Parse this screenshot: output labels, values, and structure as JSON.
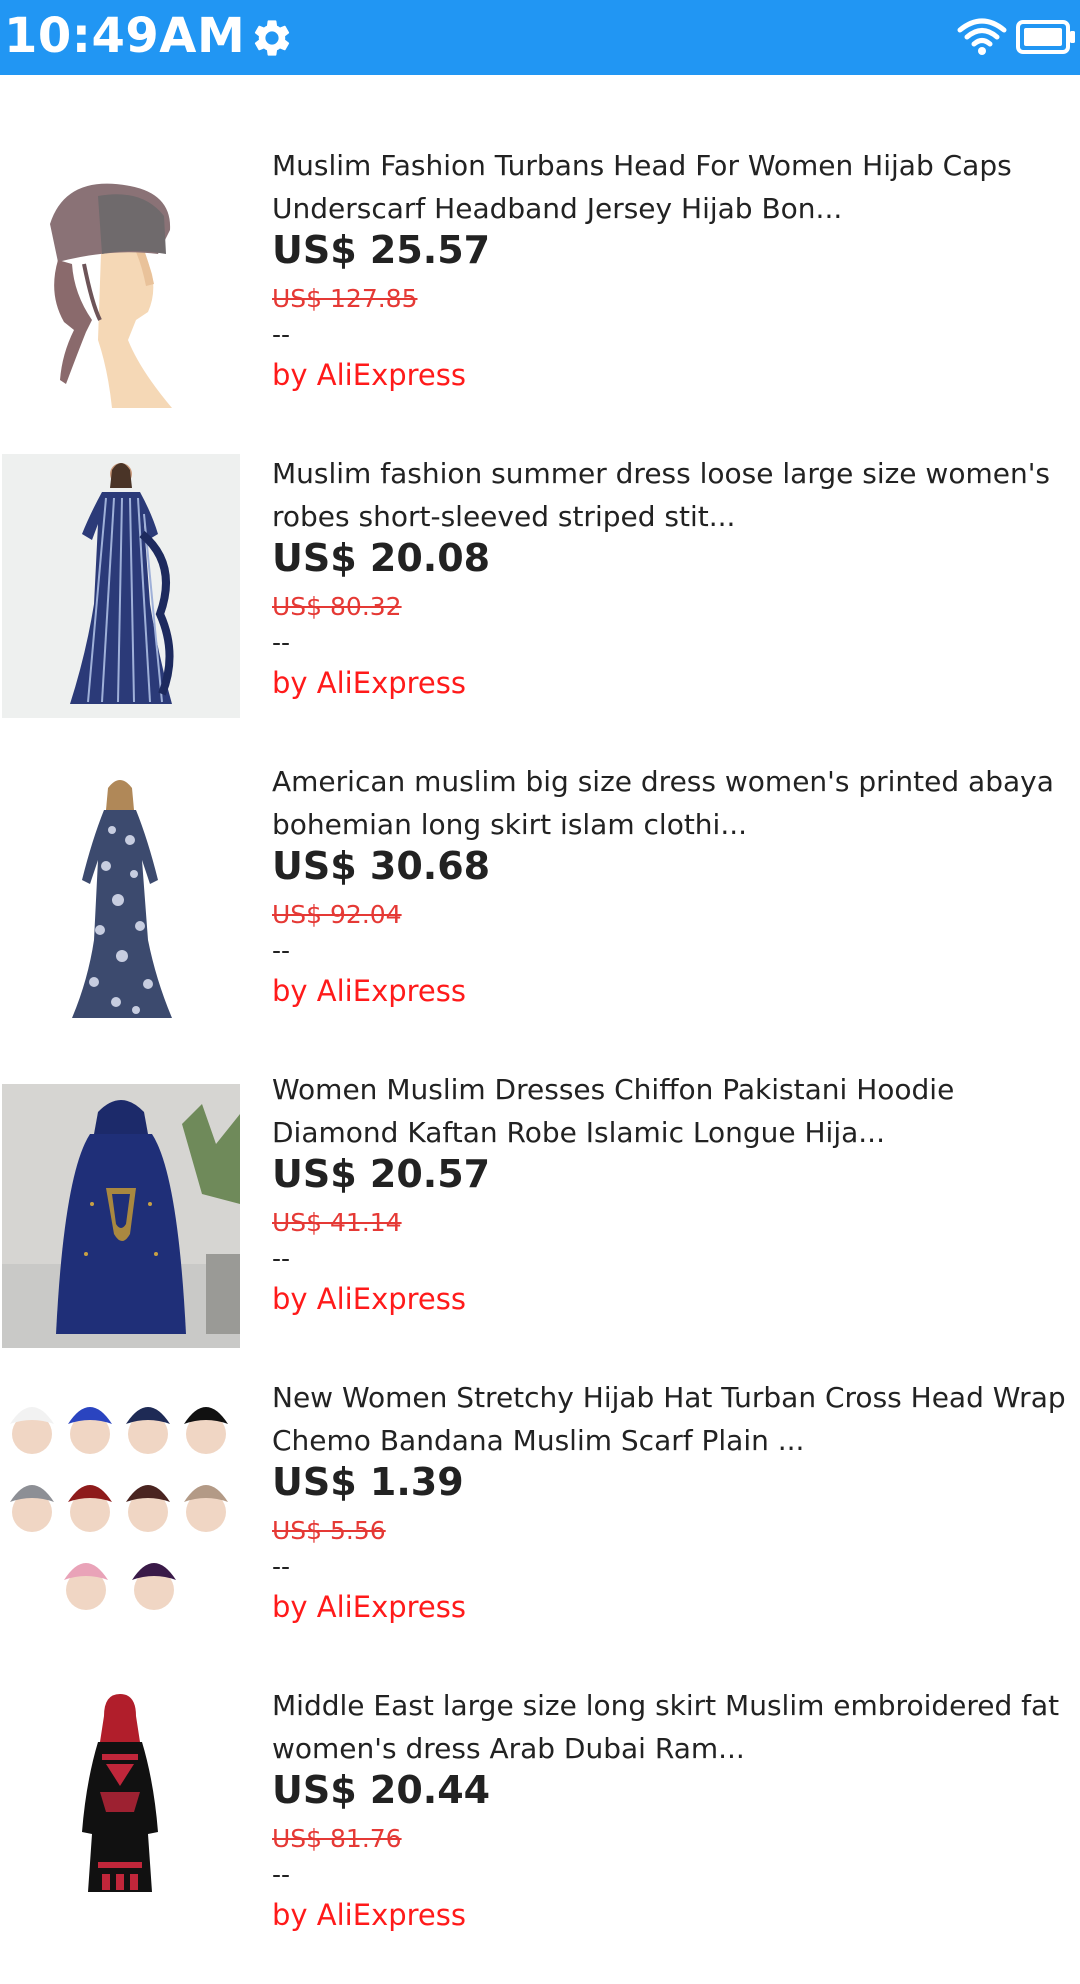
{
  "status_bar": {
    "time": "10:49AM",
    "icons": [
      "gear-icon",
      "wifi-icon",
      "battery-icon"
    ],
    "color": "#2196F3"
  },
  "products": [
    {
      "title": "Muslim Fashion Turbans Head For Women Hijab Caps Underscarf Headband Jersey Hijab Bon...",
      "price": "US$ 25.57",
      "original_price": "US$ 127.85",
      "extra": "--",
      "seller": "by AliExpress",
      "image": "turban-cap-on-mannequin"
    },
    {
      "title": "Muslim fashion summer dress loose large size women's robes short-sleeved striped stit...",
      "price": "US$ 20.08",
      "original_price": "US$ 80.32",
      "extra": "--",
      "seller": "by AliExpress",
      "image": "striped-blue-dress"
    },
    {
      "title": "American muslim big size dress women's printed abaya bohemian long skirt islam clothi...",
      "price": "US$ 30.68",
      "original_price": "US$ 92.04",
      "extra": "--",
      "seller": "by AliExpress",
      "image": "printed-floral-dress"
    },
    {
      "title": "Women Muslim Dresses Chiffon Pakistani Hoodie Diamond Kaftan Robe Islamic Longue Hija...",
      "price": "US$ 20.57",
      "original_price": "US$ 41.14",
      "extra": "--",
      "seller": "by AliExpress",
      "image": "navy-kaftan-robe"
    },
    {
      "title": "New Women Stretchy Hijab Hat Turban Cross Head Wrap Chemo Bandana Muslim Scarf Plain ...",
      "price": "US$ 1.39",
      "original_price": "US$ 5.56",
      "extra": "--",
      "seller": "by AliExpress",
      "image": "turban-color-grid"
    },
    {
      "title": "Middle East large size long skirt Muslim embroidered fat women's dress Arab Dubai Ram...",
      "price": "US$ 20.44",
      "original_price": "US$ 81.76",
      "extra": "--",
      "seller": "by AliExpress",
      "image": "black-embroidered-dress"
    }
  ],
  "colors": {
    "price_text": "#222222",
    "original_price": "#e53935",
    "seller": "#ff1a1a"
  }
}
